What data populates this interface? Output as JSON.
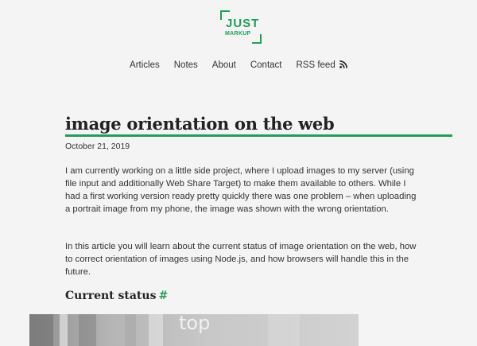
{
  "logo": {
    "line1": "JUST",
    "line2": "MARKUP"
  },
  "nav": {
    "articles": "Articles",
    "notes": "Notes",
    "about": "About",
    "contact": "Contact",
    "rss": "RSS feed"
  },
  "article": {
    "title": "image orientation on the web",
    "date": "October 21, 2019",
    "paragraph1": "I am currently working on a little side project, where I upload images to my server (using file input and additionally Web Share Target) to make them available to others. While I had a first working version ready pretty quickly there was one problem – when uploading a portrait image from my phone, the image was shown with the wrong orientation.",
    "paragraph2": "In this article you will learn about the current status of image orientation on the web, how to correct orientation of images using Node.js, and how browsers will handle this in the future.",
    "section_heading": "Current status",
    "section_anchor": "#",
    "figure_label": "top"
  },
  "colors": {
    "accent": "#1fa055",
    "background": "#f4f4f4"
  },
  "icons": {
    "rss": "rss-icon"
  }
}
